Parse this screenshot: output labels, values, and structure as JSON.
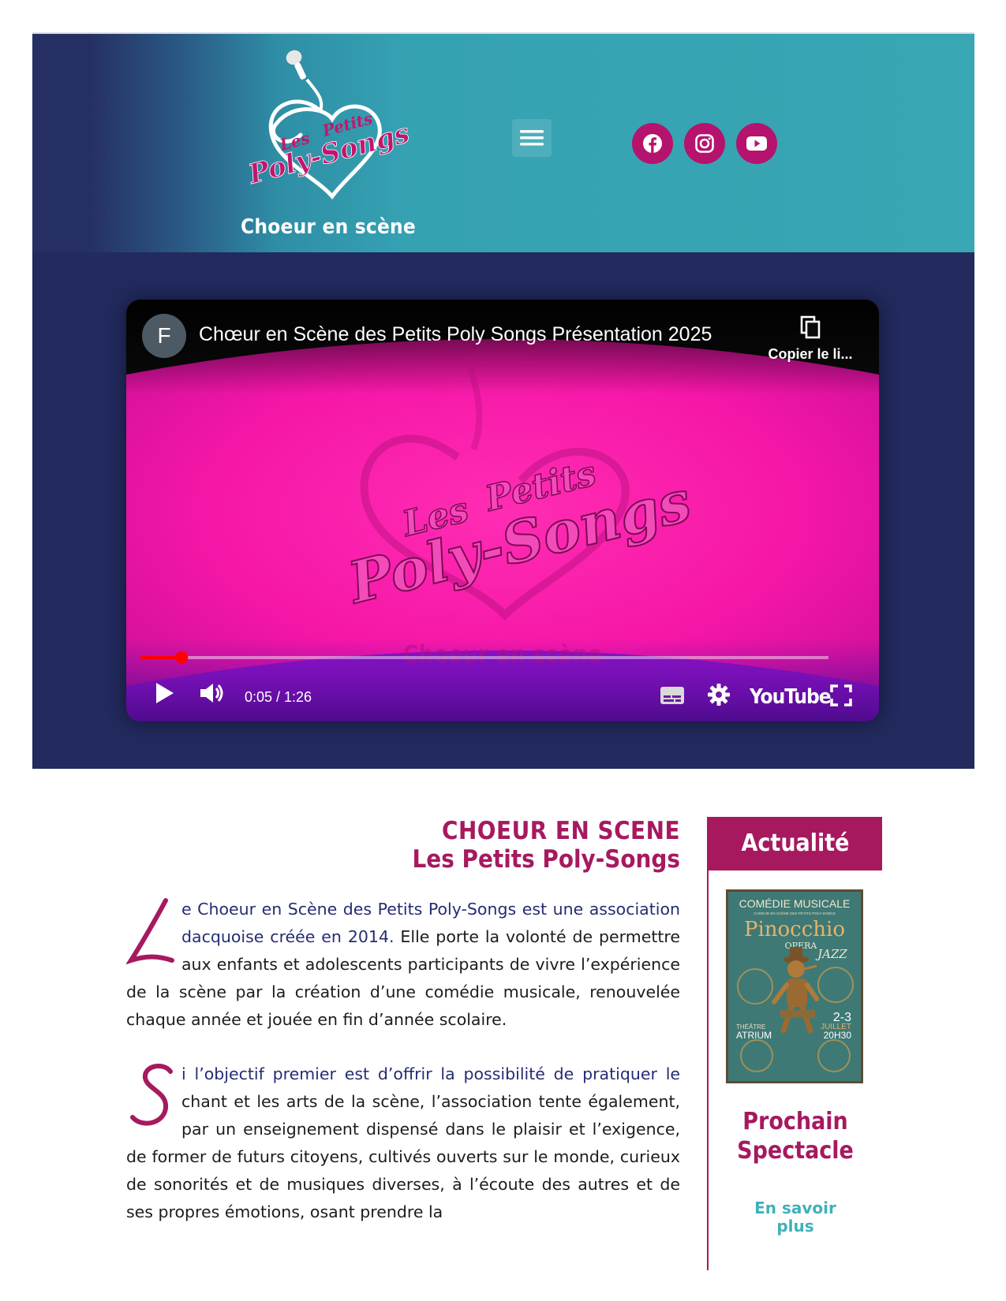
{
  "header": {
    "logo_text_les": "Les",
    "logo_text_petits": "Petits",
    "logo_text_name": "Poly-Songs",
    "tagline": "Choeur en scène",
    "menu_icon": "hamburger-menu-icon",
    "social": [
      {
        "name": "facebook",
        "icon": "facebook-icon"
      },
      {
        "name": "instagram",
        "icon": "instagram-icon"
      },
      {
        "name": "youtube",
        "icon": "youtube-icon"
      }
    ],
    "accent_color": "#b5136e"
  },
  "video": {
    "channel_initial": "F",
    "title": "Chœur en Scène des Petits Poly Songs Présentation 2025",
    "copy_link_label": "Copier le li...",
    "time": "0:05 / 1:26",
    "brand": "YouTube",
    "overlay_les": "Les",
    "overlay_petits": "Petits",
    "overlay_name": "Poly-Songs",
    "overlay_tagline": "Choeur en scène",
    "progress": 0.06
  },
  "article": {
    "title_line1": "CHOEUR EN SCENE",
    "title_line2": "Les Petits Poly-Songs",
    "p1_dropcap": "L",
    "p1_highlight": "e Choeur en Scène des Petits Poly-Songs est une association dacquoise créée en 2014.",
    "p1_rest": " Elle porte la volonté de permettre aux enfants et adolescents participants de vivre l’expérience de la scène par la création d’une comédie musicale, renouvelée chaque année et jouée en fin d’année scolaire.",
    "p2_dropcap": "S",
    "p2_highlight": "i l’objectif premier est d’offrir la possibilité de pratiquer le",
    "p2_rest": " chant et les arts de la scène, l’association tente également, par un enseignement dispensé dans le plaisir et l’exigence, de former de futurs citoyens, cultivés ouverts sur le monde, curieux de sonorités et de musiques diverses, à l’écoute des autres et de ses propres émotions, osant prendre la"
  },
  "sidebar": {
    "heading": "Actualité",
    "poster": {
      "genre": "COMÉDIE MUSICALE",
      "subtitle": "CHOEUR EN SCÈNE DES PETITS POLY-SONGS",
      "show": "Pinocchio",
      "opera": "OPERA",
      "jazz": "JAZZ",
      "dates": "2-3",
      "month": "JUILLET",
      "hour": "20H30",
      "venue_line1": "THÉÂTRE",
      "venue_line2": "ATRIUM"
    },
    "next_title_line1": "Prochain",
    "next_title_line2": "Spectacle",
    "more_line1": "En savoir",
    "more_line2": "plus"
  }
}
